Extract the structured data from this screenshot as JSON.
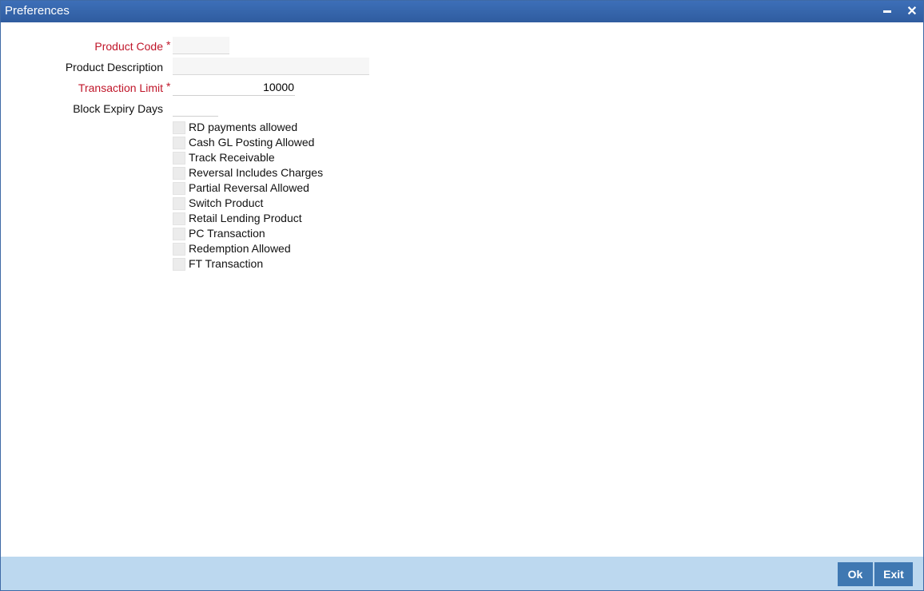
{
  "window": {
    "title": "Preferences",
    "minimize_icon": "minimize-icon",
    "close_icon": "close-icon",
    "close_glyph": "✕"
  },
  "form": {
    "product_code": {
      "label": "Product Code",
      "required": true,
      "value": ""
    },
    "product_description": {
      "label": "Product Description",
      "required": false,
      "value": ""
    },
    "transaction_limit": {
      "label": "Transaction Limit",
      "required": true,
      "value": "10000"
    },
    "block_expiry_days": {
      "label": "Block Expiry Days",
      "required": false,
      "value": ""
    },
    "required_marker": "*"
  },
  "checkboxes": [
    {
      "label": "RD payments allowed",
      "checked": false
    },
    {
      "label": "Cash GL Posting Allowed",
      "checked": false
    },
    {
      "label": "Track Receivable",
      "checked": false
    },
    {
      "label": "Reversal Includes Charges",
      "checked": false
    },
    {
      "label": "Partial Reversal Allowed",
      "checked": false
    },
    {
      "label": "Switch Product",
      "checked": false
    },
    {
      "label": "Retail Lending Product",
      "checked": false
    },
    {
      "label": "PC Transaction",
      "checked": false
    },
    {
      "label": "Redemption Allowed",
      "checked": false
    },
    {
      "label": "FT Transaction",
      "checked": false
    }
  ],
  "footer": {
    "ok_label": "Ok",
    "exit_label": "Exit"
  },
  "colors": {
    "titlebar": "#3465ac",
    "required_label": "#c0162a",
    "footer_bg": "#bcd8ef",
    "button_bg": "#3f78b2"
  }
}
